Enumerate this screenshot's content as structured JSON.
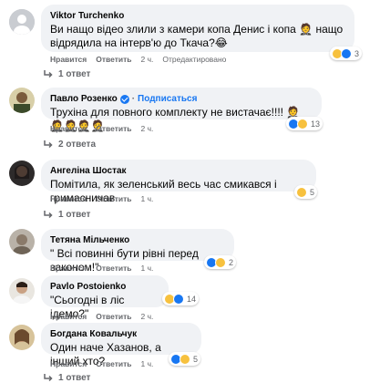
{
  "actions": {
    "like": "Нравится",
    "reply": "Ответить"
  },
  "comments": [
    {
      "author": "Viktor Turchenko",
      "text": "Ви нащо відео злили з камери копа Денис і копа 🤵 нащо відрядила на інтерв'ю до Ткача?😂",
      "time": "2 ч.",
      "edited": "Отредактировано",
      "reactions": "3",
      "replies": "1 ответ"
    },
    {
      "author": "Павло Розенко",
      "subscribe": "Подписаться",
      "text": "Трухіна для повного комплекту не вистачає!!!! 🤵🤵🤵🤵🤵",
      "time": "2 ч.",
      "reactions": "13",
      "replies": "2 ответа"
    },
    {
      "author": "Ангеліна Шостак",
      "text": "Помітила, як зеленський весь час смикався і гримасничав.",
      "time": "1 ч.",
      "reactions": "5",
      "replies": "1 ответ"
    },
    {
      "author": "Тетяна Мільченко",
      "text": "\" Всі повинні бути рівні перед законом!\"",
      "time": "1 ч.",
      "reactions": "2"
    },
    {
      "author": "Pavlo Postoienko",
      "text": "\"Сьогодні в ліс ідемо?\"",
      "time": "2 ч.",
      "reactions": "14"
    },
    {
      "author": "Богдана Ковальчук",
      "text": "Один наче Хазанов, а інший хто?",
      "time": "1 ч.",
      "reactions": "5",
      "replies": "1 ответ"
    }
  ],
  "colors": {
    "accent": "#1877f2",
    "bubble": "#f0f2f5",
    "muted": "#65676b"
  }
}
